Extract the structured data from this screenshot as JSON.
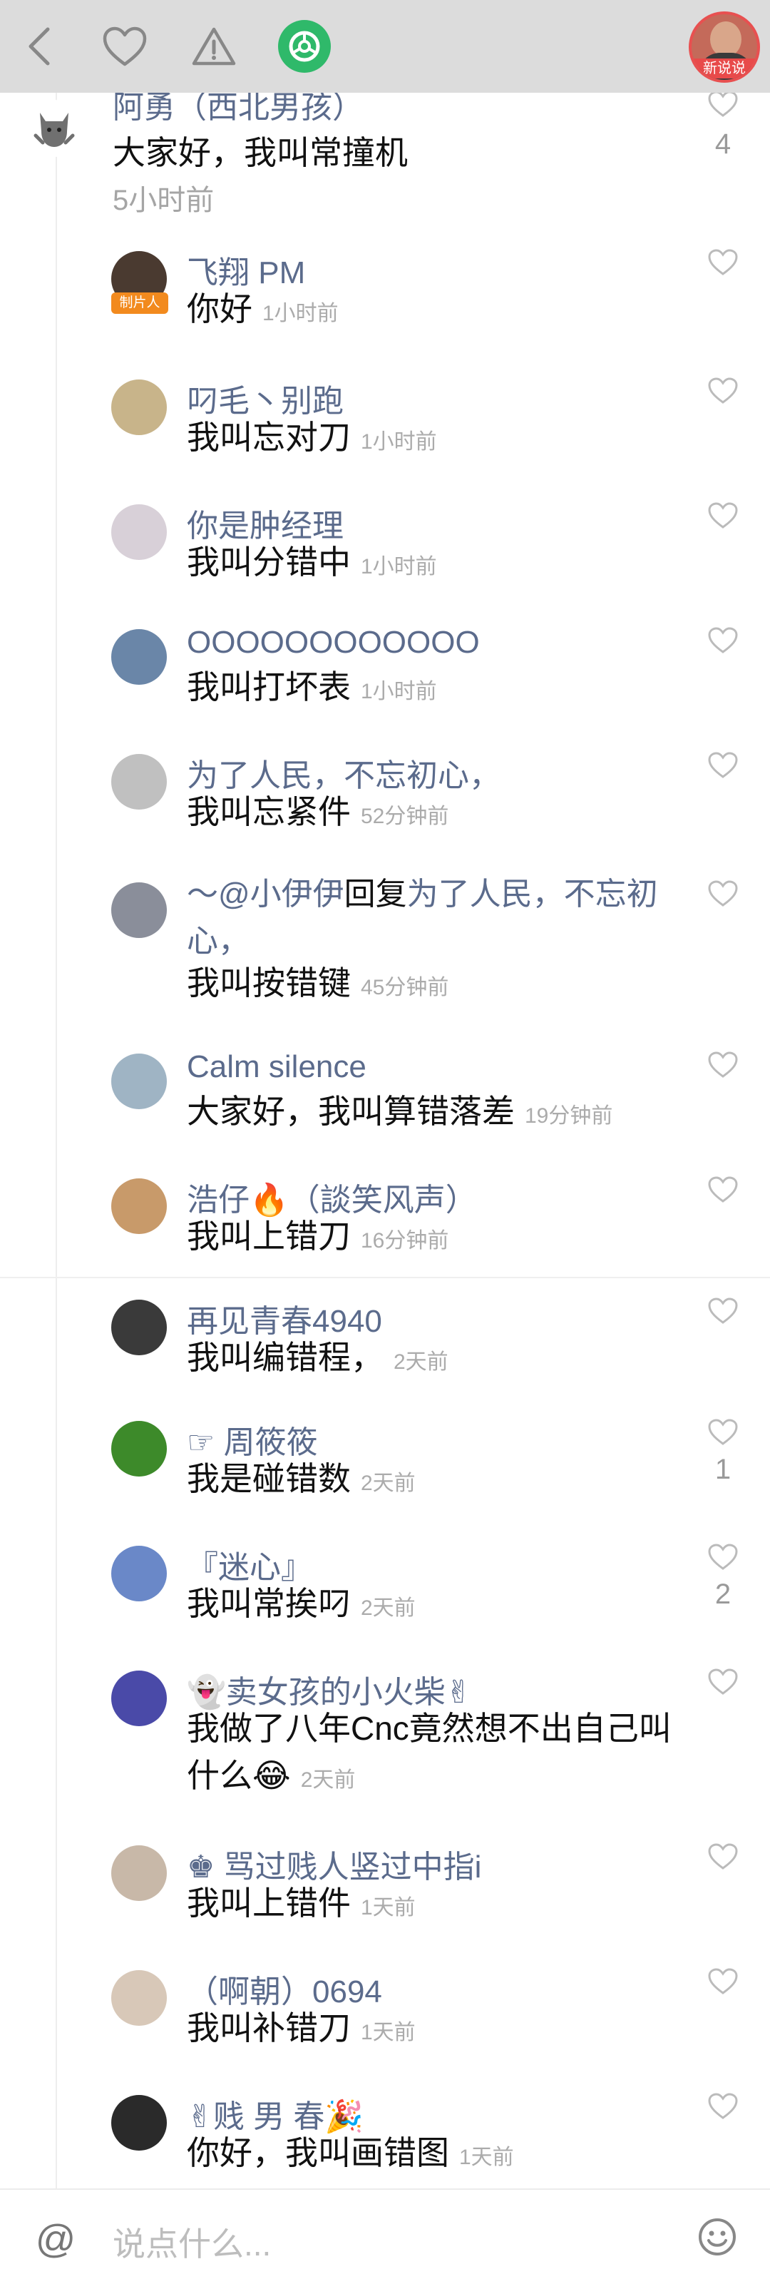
{
  "topbar": {
    "icons": [
      "back-icon",
      "heart-icon",
      "warning-icon",
      "share-icon"
    ],
    "avatar_badge": "新说说",
    "share_color": "#2fb96a"
  },
  "root": {
    "name": "阿勇（西北男孩）",
    "text": "大家好，我叫常撞机",
    "time": "5小时前",
    "likes": "4"
  },
  "replies": [
    {
      "name": "飞翔 PM",
      "badge": "制片人",
      "text": "你好",
      "time": "1小时前"
    },
    {
      "name": "叼毛丶别跑",
      "text": "我叫忘对刀",
      "time": "1小时前"
    },
    {
      "name": "你是肿经理",
      "text": "我叫分错中",
      "time": "1小时前"
    },
    {
      "name": "OOOOOOOOOOOO",
      "text": "我叫打坏表",
      "time": "1小时前"
    },
    {
      "name": "为了人民，不忘初心，",
      "text": "我叫忘紧件",
      "time": "52分钟前"
    },
    {
      "name": "～@小伊伊",
      "reply_word": "回复",
      "reply_target": "为了人民，不忘初心，",
      "text": "我叫按错键",
      "time": "45分钟前"
    },
    {
      "name": "Calm silence",
      "text": "大家好，我叫算错落差",
      "time": "19分钟前"
    },
    {
      "name": "浩仔🔥（談笑风声）",
      "text": "我叫上错刀",
      "time": "16分钟前"
    },
    {
      "name": "再见青春4940",
      "text": "我叫编错程，",
      "time": "2天前"
    },
    {
      "name": "☞ 周筱筱",
      "text": "我是碰错数",
      "time": "2天前",
      "likes": "1"
    },
    {
      "name": "『迷心』",
      "text": "我叫常挨叼",
      "time": "2天前",
      "likes": "2"
    },
    {
      "name": "👻卖女孩的小火柴✌",
      "text": "我做了八年Cnc竟然想不出自己叫什么😂",
      "time": "2天前"
    },
    {
      "name": "♚ 骂过贱人竖过中指i",
      "text": "我叫上错件",
      "time": "1天前"
    },
    {
      "name": "（啊朝）0694",
      "text": "我叫补错刀",
      "time": "1天前"
    },
    {
      "name": "✌贱 男 春🎉",
      "text": "你好，我叫画错图",
      "time": "1天前"
    }
  ],
  "input": {
    "placeholder": "说点什么..."
  },
  "colors": {
    "name": "#5b6b8c",
    "time": "#ababab",
    "topbar_bg": "#dcdcdc"
  }
}
